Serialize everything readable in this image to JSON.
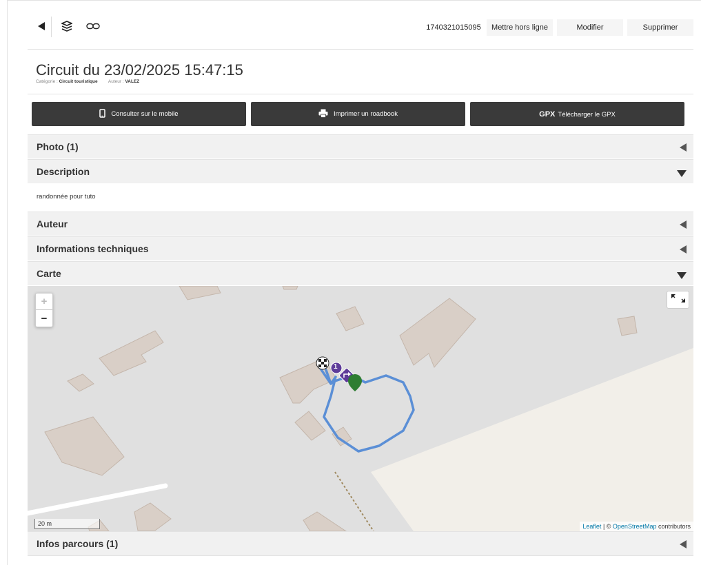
{
  "toolbar": {
    "back_icon": "back-triangle-icon",
    "layers_icon": "layers-icon",
    "link_icon": "link-icon",
    "id_label": "1740321015095",
    "offline_label": "Mettre hors ligne",
    "edit_label": "Modifier",
    "delete_label": "Supprimer"
  },
  "header": {
    "title": "Circuit du 23/02/2025 15:47:15",
    "category_label": "Catégorie :",
    "category_value": "Circuit touristique",
    "author_label": "Auteur :",
    "author_value": "VALEZ"
  },
  "actions": {
    "mobile_label": "Consulter sur le mobile",
    "print_label": "Imprimer un roadbook",
    "gpx_badge": "GPX",
    "gpx_label": "Télécharger le GPX"
  },
  "sections": {
    "photo": "Photo (1)",
    "description": "Description",
    "description_text": "randonnée pour tuto",
    "auteur": "Auteur",
    "infos_tech": "Informations techniques",
    "carte": "Carte",
    "infos_parcours": "Infos parcours (1)"
  },
  "map": {
    "zoom_in": "+",
    "zoom_out": "−",
    "scale_label": "20 m",
    "attrib_leaflet": "Leaflet",
    "attrib_sep": " | © ",
    "attrib_osm": "OpenStreetMap",
    "attrib_contrib": " contributors",
    "marker_number": "1",
    "route_color": "#5b8fd6",
    "start_marker_color": "#2e7d32",
    "waypoint_color": "#5e3c99"
  }
}
